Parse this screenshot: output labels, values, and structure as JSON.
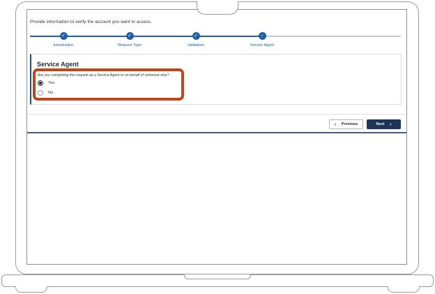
{
  "page": {
    "instruction": "Provide information to verify the account you want to access."
  },
  "stepper": {
    "steps": [
      {
        "label": "Introduction",
        "status": "completed",
        "icon": "check-icon"
      },
      {
        "label": "Request Type",
        "status": "completed",
        "icon": "check-icon"
      },
      {
        "label": "Validation",
        "status": "completed",
        "icon": "check-icon"
      },
      {
        "label": "Service Agent",
        "status": "current",
        "icon": "chevron-right-icon"
      }
    ]
  },
  "form": {
    "title": "Service Agent",
    "question": "Are you completing this request as a Service Agent or on behalf of someone else?",
    "options": [
      {
        "label": "Yes",
        "selected": true
      },
      {
        "label": "No",
        "selected": false
      }
    ]
  },
  "navigation": {
    "previous_label": "Previous",
    "next_label": "Next"
  },
  "colors": {
    "accent": "#1f5fa8",
    "primary_button": "#1d3557",
    "highlight": "#c0471b"
  }
}
